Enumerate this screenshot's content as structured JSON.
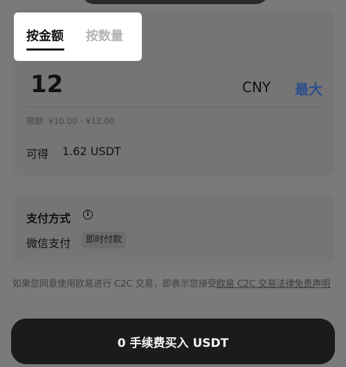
{
  "tabs": {
    "by_amount": "按金额",
    "by_quantity": "按数量"
  },
  "amount": {
    "value": "12",
    "currency": "CNY",
    "max_label": "最大"
  },
  "limit_text": "限额: ¥10.00 - ¥12.00",
  "receive": {
    "label": "可得",
    "value": "1.62 USDT"
  },
  "payment": {
    "title": "支付方式",
    "info_icon": "ⓘ",
    "method": "微信支付",
    "badge": "即时付款"
  },
  "disclaimer": {
    "text": "如果您同意使用欧易进行 C2C 交易，即表示您接受",
    "link": "欧易 C2C 交易法律免责声明"
  },
  "buy_button": "0 手续费买入 USDT"
}
